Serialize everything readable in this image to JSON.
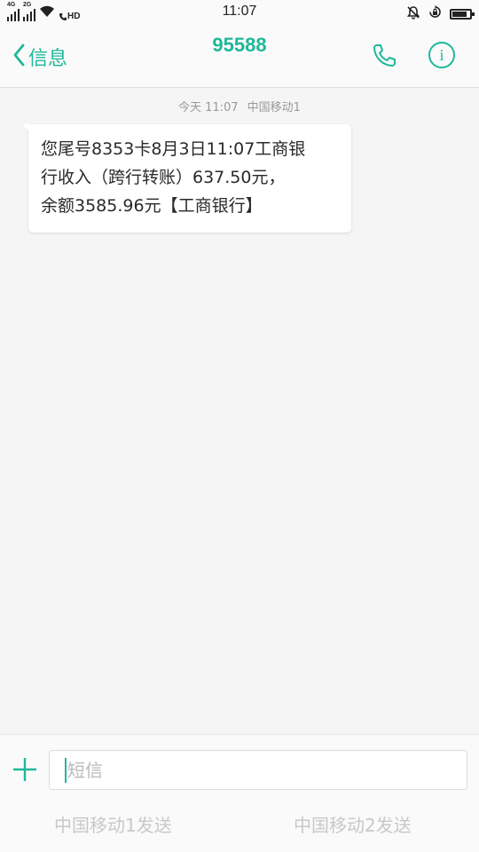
{
  "status_bar": {
    "sim1_network": "4G",
    "sim2_network": "2G",
    "hd_label": "HD",
    "time": "11:07",
    "battery_level": 0.85
  },
  "header": {
    "back_label": "信息",
    "title": "95588",
    "accent_color": "#1eb89a"
  },
  "conversation": {
    "meta_day_time": "今天 11:07",
    "meta_carrier": "中国移动1",
    "messages": [
      {
        "lines": [
          "您尾号8353卡8月3日11:07工商银",
          "行收入（跨行转账）637.50元，",
          "余额3585.96元【工商银行】"
        ]
      }
    ]
  },
  "compose": {
    "placeholder": "短信",
    "send_sim1_label": "中国移动1发送",
    "send_sim2_label": "中国移动2发送"
  },
  "icons": {
    "back": "chevron-left-icon",
    "call": "phone-icon",
    "info": "info-icon",
    "add": "plus-icon"
  }
}
